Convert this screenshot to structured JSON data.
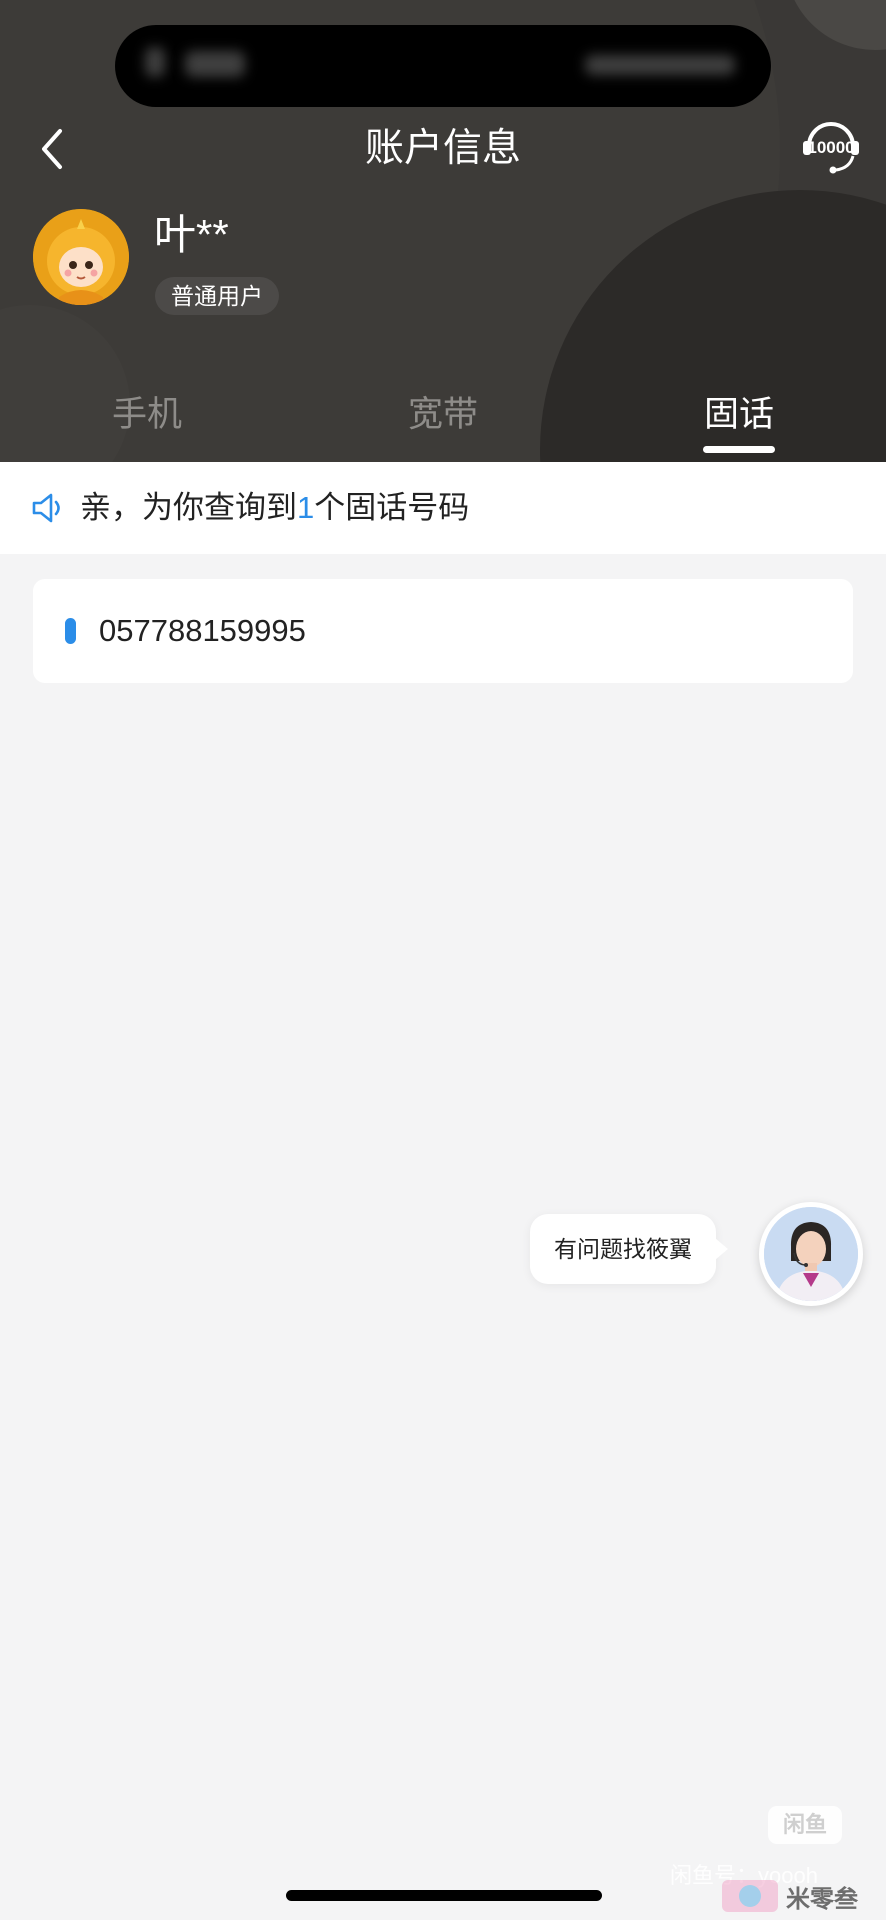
{
  "header": {
    "title": "账户信息",
    "back_icon": "chevron-left-icon",
    "service_icon": "10000-hotline-icon",
    "service_label": "10000"
  },
  "user": {
    "name": "叶**",
    "badge": "普通用户"
  },
  "tabs": [
    {
      "label": "手机",
      "active": false
    },
    {
      "label": "宽带",
      "active": false
    },
    {
      "label": "固话",
      "active": true
    }
  ],
  "notice": {
    "icon": "speaker-icon",
    "prefix": "亲，为你查询到",
    "count": "1",
    "suffix": "个固话号码"
  },
  "numbers": [
    {
      "value": "057788159995"
    }
  ],
  "assistant": {
    "prompt": "有问题找筱翼"
  },
  "watermark": {
    "logo": "闲鱼",
    "text": "闲鱼号：yoooh",
    "brand": "米零叁"
  },
  "colors": {
    "header_bg": "#3a3836",
    "accent": "#2b8de8",
    "page_bg": "#f4f4f5"
  }
}
